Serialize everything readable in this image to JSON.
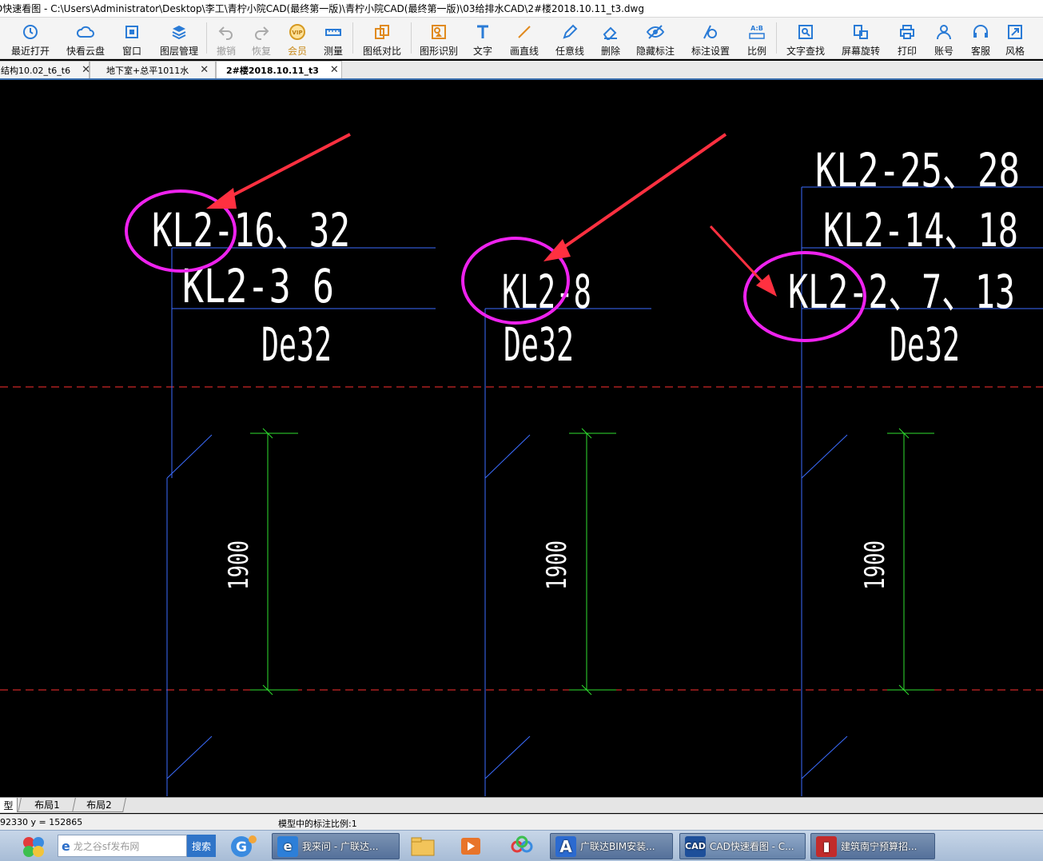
{
  "window": {
    "title": "D快速看图 - C:\\Users\\Administrator\\Desktop\\李工\\青柠小院CAD(最终第一版)\\青柠小院CAD(最终第一版)\\03给排水CAD\\2#楼2018.10.11_t3.dwg"
  },
  "toolbar": {
    "recent_open": "最近打开",
    "cloud": "快看云盘",
    "window": "窗口",
    "layers": "图层管理",
    "undo": "撤销",
    "redo": "恢复",
    "member": "会员",
    "measure": "测量",
    "compare": "图纸对比",
    "shape_recognize": "图形识别",
    "text": "文字",
    "line": "画直线",
    "freehand": "任意线",
    "delete": "删除",
    "hide_annotations": "隐藏标注",
    "annotation_settings": "标注设置",
    "scale": "比例",
    "text_search": "文字查找",
    "rotate_screen": "屏幕旋转",
    "print": "打印",
    "account": "账号",
    "support": "客服",
    "style": "风格"
  },
  "tabs": [
    {
      "label": "结构10.02_t6_t6",
      "active": false
    },
    {
      "label": "地下室+总平1011水",
      "active": false
    },
    {
      "label": "2#楼2018.10.11_t3",
      "active": true
    }
  ],
  "drawing": {
    "colors": {
      "text": "#ffffff",
      "pipe": "#3b6cff",
      "dimension": "#2fe02f",
      "axis": "#ff3030",
      "circle": "#ee22ee",
      "arrow": "#ff3040"
    },
    "labels": {
      "col1_line1": "KL2-16、32",
      "col1_line2": "KL2-3 6",
      "col1_size": "De32",
      "col2_line1": "KL2-8",
      "col2_size": "De32",
      "col3_line1": "KL2-25、28",
      "col3_line2": "KL2-14、18",
      "col3_line3": "KL2-2、7、13",
      "col3_size": "De32",
      "dim1": "1900",
      "dim2": "1900",
      "dim3": "1900"
    }
  },
  "layout_tabs": {
    "model": "型",
    "layout1": "布局1",
    "layout2": "布局2"
  },
  "status": {
    "coords": "92330  y = 152865",
    "scale_text": "模型中的标注比例:1"
  },
  "taskbar": {
    "search_placeholder": "龙之谷sf发布网",
    "search_button": "搜索",
    "items": [
      {
        "label": "我来问 - 广联达..."
      },
      {
        "label": "广联达BIM安装..."
      },
      {
        "label": "CAD快速看图 - C..."
      },
      {
        "label": "建筑南宁预算招..."
      }
    ]
  }
}
